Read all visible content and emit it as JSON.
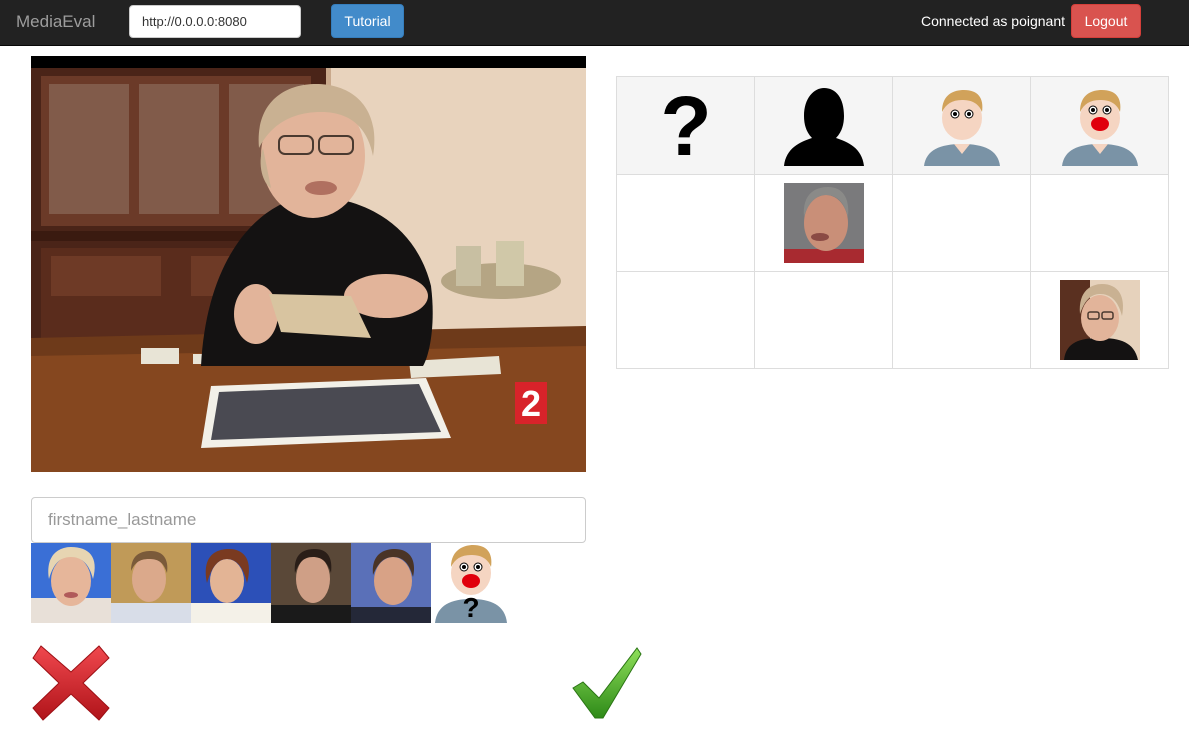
{
  "navbar": {
    "brand": "MediaEval",
    "server_url": "http://0.0.0.0:8080",
    "tutorial_label": "Tutorial",
    "connected_text": "Connected as poignant",
    "logout_label": "Logout"
  },
  "video": {
    "channel_logo": "2"
  },
  "name_input": {
    "placeholder": "firstname_lastname",
    "value": ""
  },
  "suggestions": [
    {
      "name": "face-thumbnail",
      "kind": "photo"
    },
    {
      "name": "face-thumbnail",
      "kind": "photo"
    },
    {
      "name": "face-thumbnail",
      "kind": "photo"
    },
    {
      "name": "face-thumbnail",
      "kind": "photo"
    },
    {
      "name": "face-thumbnail",
      "kind": "photo"
    },
    {
      "name": "unknown-person-icon",
      "kind": "icon"
    }
  ],
  "actions": {
    "reject_icon": "red-cross-icon",
    "accept_icon": "green-check-icon"
  },
  "grid": {
    "columns": [
      {
        "icon": "question-mark-icon"
      },
      {
        "icon": "silhouette-icon"
      },
      {
        "icon": "person-icon"
      },
      {
        "icon": "person-speaking-icon"
      }
    ],
    "rows": [
      {
        "filled_column": 1
      },
      {
        "filled_column": 3
      }
    ]
  },
  "colors": {
    "navbar_bg": "#222222",
    "primary": "#428bca",
    "danger": "#d9534f",
    "reject": "#d9232a",
    "accept": "#4fb82a"
  }
}
